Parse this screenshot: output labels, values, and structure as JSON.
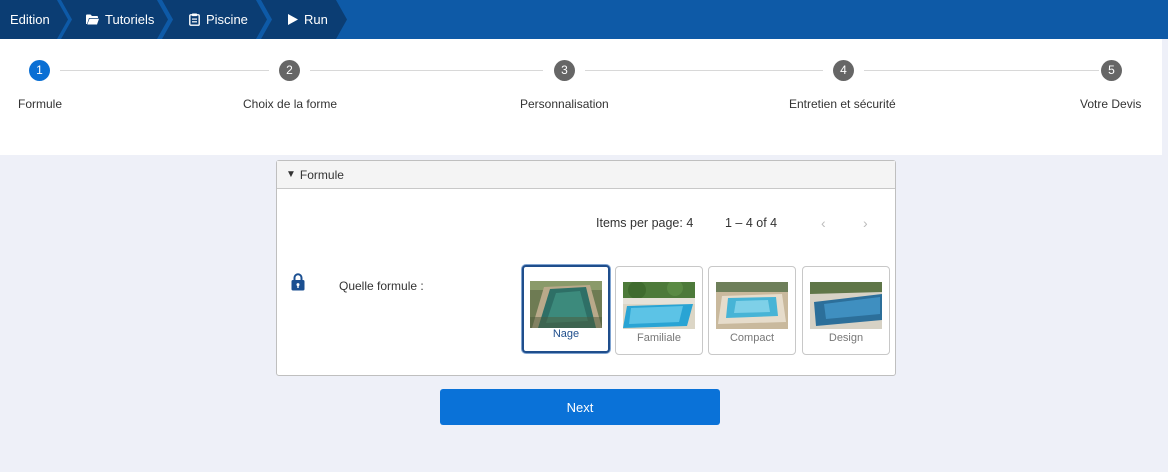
{
  "breadcrumb": {
    "items": [
      {
        "label": "Edition",
        "icon": "none"
      },
      {
        "label": "Tutoriels",
        "icon": "folder-icon"
      },
      {
        "label": "Piscine",
        "icon": "clipboard-icon"
      },
      {
        "label": "Run",
        "icon": "play-icon"
      }
    ]
  },
  "stepper": {
    "steps": [
      {
        "number": "1",
        "label": "Formule",
        "active": true
      },
      {
        "number": "2",
        "label": "Choix de la forme",
        "active": false
      },
      {
        "number": "3",
        "label": "Personnalisation",
        "active": false
      },
      {
        "number": "4",
        "label": "Entretien et sécurité",
        "active": false
      },
      {
        "number": "5",
        "label": "Votre Devis",
        "active": false
      }
    ]
  },
  "panel": {
    "title": "Formule",
    "pager": {
      "items_per_page_label": "Items per page:",
      "items_per_page_value": "4",
      "range": "1 – 4 of 4",
      "prev": "‹",
      "next": "›"
    },
    "field_label": "Quelle formule  :",
    "options": [
      {
        "label": "Nage",
        "selected": true
      },
      {
        "label": "Familiale",
        "selected": false
      },
      {
        "label": "Compact",
        "selected": false
      },
      {
        "label": "Design",
        "selected": false
      }
    ]
  },
  "actions": {
    "next_label": "Next"
  },
  "colors": {
    "topbar": "#0e5aa7",
    "crumb": "#0b3d73",
    "active_step": "#0a6fd4",
    "inactive_step": "#666666",
    "primary_button": "#0a72d8",
    "selected_card_border": "#1f4e8c"
  }
}
